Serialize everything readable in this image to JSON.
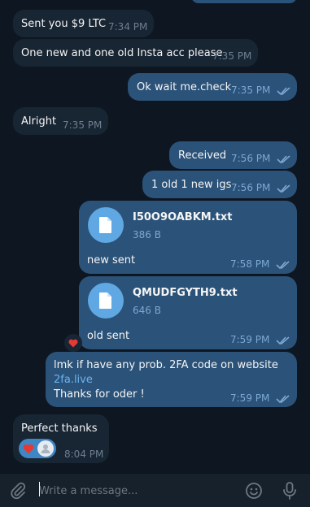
{
  "messages": [
    {
      "text": "Sent you $9 LTC",
      "time": "7:34 PM"
    },
    {
      "text": "One new and one old Insta acc please",
      "time": "7:35 PM"
    },
    {
      "text": "Ok wait me.check",
      "time": "7:35 PM"
    },
    {
      "text": "Alright",
      "time": "7:35 PM"
    },
    {
      "text": "Received",
      "time": "7:56 PM"
    },
    {
      "text": "1 old 1 new igs",
      "time": "7:56 PM"
    },
    {
      "file_name": "I50O9OABKM.txt",
      "file_size": "386 B",
      "caption": "new sent",
      "time": "7:58 PM"
    },
    {
      "file_name": "QMUDFGYTH9.txt",
      "file_size": "646 B",
      "caption": "old sent",
      "time": "7:59 PM"
    },
    {
      "line1": "lmk if have any prob. 2FA code on website",
      "link": "2fa.live",
      "line3": "Thanks for oder !",
      "time": "7:59 PM"
    },
    {
      "text": "Perfect thanks",
      "time": "8:04 PM"
    }
  ],
  "composer": {
    "placeholder": "Write a message..."
  },
  "icons": {
    "attach": "paperclip-icon",
    "emoji": "smiley-icon",
    "mic": "microphone-icon",
    "file": "document-icon",
    "read": "double-check-icon",
    "reaction": "red-heart"
  },
  "colors": {
    "background": "#0e1621",
    "incoming": "#182533",
    "outgoing": "#2b5278",
    "accent": "#5fa8e3",
    "link": "#6ab3f3"
  }
}
